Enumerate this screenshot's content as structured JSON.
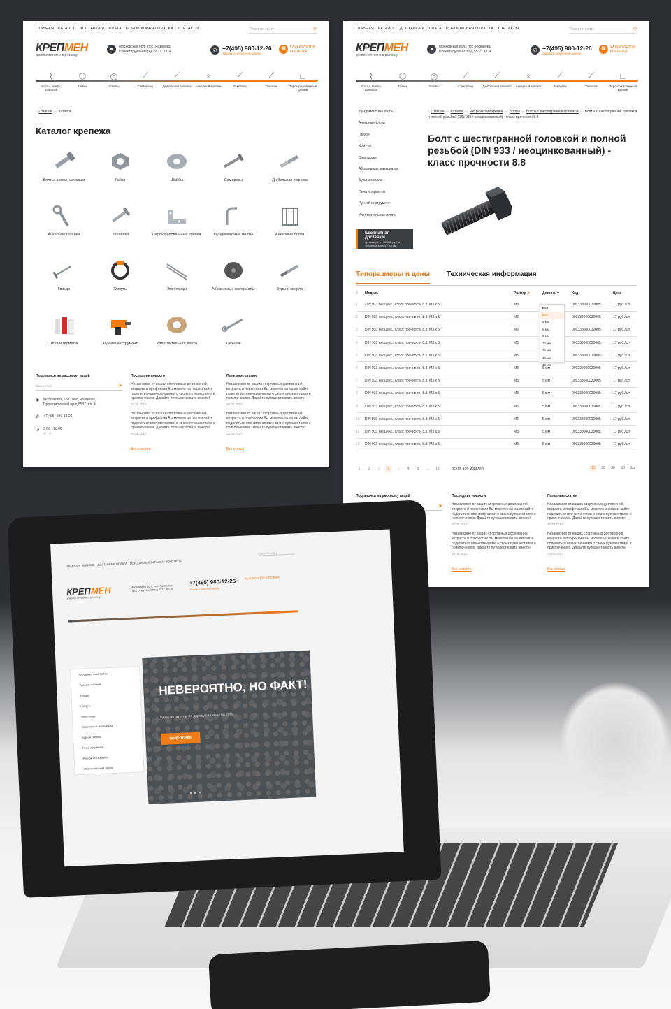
{
  "header": {
    "nav": [
      "ГЛАВНАЯ",
      "КАТАЛОГ",
      "ДОСТАВКА И ОПЛАТА",
      "ПОРОШКОВАЯ ОКРАСКА",
      "КОНТАКТЫ"
    ],
    "search_placeholder": "Поиск по сайту",
    "logo_dark": "КРЕП",
    "logo_orange": "МЕН",
    "slogan": "крепёж оптом и в розницу",
    "address": "Московская обл., пос. Развилка, Проектируемый пр-д 5537, вл. 4",
    "phone": "+7(495) 980-12-26",
    "callback": "Заказать обратный звонок",
    "calc": "КАЛЬКУЛЯТОР КРЕПЕЖА"
  },
  "category_strip": [
    "Болты, винты, шпильки",
    "Гайки",
    "Шайбы",
    "Саморезы",
    "Дюбельная техника",
    "Анкерный крепеж",
    "Заклёпки",
    "Такелаж",
    "Перфорированный крепеж"
  ],
  "left_page": {
    "breadcrumb": {
      "home": "Главная",
      "current": "Каталог"
    },
    "title": "Каталог крепежа",
    "catalog": [
      {
        "name": "Болты, винты, шпильки",
        "icon": "bolt-icon"
      },
      {
        "name": "Гайки",
        "icon": "nut-icon"
      },
      {
        "name": "Шайбы",
        "icon": "washer-icon"
      },
      {
        "name": "Саморезы",
        "icon": "screw-icon"
      },
      {
        "name": "Дюбельная техника",
        "icon": "dowel-icon"
      },
      {
        "name": "Анкерная техника",
        "icon": "anchor-icon"
      },
      {
        "name": "Заклёпки",
        "icon": "rivet-icon"
      },
      {
        "name": "Перфорирова-нный крепеж",
        "icon": "perforated-icon"
      },
      {
        "name": "Фундаментные болты",
        "icon": "foundation-bolt-icon"
      },
      {
        "name": "Анкерные блоки",
        "icon": "anchor-block-icon"
      },
      {
        "name": "Гвозди",
        "icon": "nail-icon"
      },
      {
        "name": "Хомуты",
        "icon": "clamp-icon"
      },
      {
        "name": "Электроды",
        "icon": "electrode-icon"
      },
      {
        "name": "Абразивные материалы",
        "icon": "abrasive-icon"
      },
      {
        "name": "Буры и сверла",
        "icon": "drill-bit-icon"
      },
      {
        "name": "Пена и герметик",
        "icon": "foam-icon"
      },
      {
        "name": "Ручной инструмент",
        "icon": "hand-tool-icon"
      },
      {
        "name": "Уплотнительная лента",
        "icon": "tape-icon"
      },
      {
        "name": "Такелаж",
        "icon": "rigging-icon"
      }
    ]
  },
  "footer": {
    "subscribe_title": "Подпишись на рассылку акций",
    "email_placeholder": "Ваш e-mail",
    "address": "Московская обл., пос. Развилка, Проектируемый пр-д 5537, вл. 4",
    "phone": "+7(495) 980-12-26",
    "hours": "9:00 - 18:00",
    "hours_days": "пн - пт",
    "news_title": "Последние новости",
    "articles_title": "Полезные статьи",
    "item_text": "Независимо от ваших спортивных достижений, возраста и профессии Вы можете на нашем сайте поделиться впечатлениями о своих путешествиях и приключениях. Давайте путешествовать вместе!",
    "item_date": "20.06.2017",
    "all_news": "Все новости",
    "all_articles": "Все статьи"
  },
  "right_page": {
    "sidebar": [
      "Фундаментные болты",
      "Анкерные блоки",
      "Гвозди",
      "Хомуты",
      "Электроды",
      "Абразивные материалы",
      "Буры и сверла",
      "Пена и герметик",
      "Ручной инструмент",
      "Уплотнительная лента"
    ],
    "promo_title": "Бесплатная доставка!",
    "promo_text": "при заказе от 10 000 руб. в пределах МКАД + 10 км",
    "breadcrumb": [
      "Главная",
      "Каталог",
      "Метрический крепеж",
      "Болты",
      "Болты с шестигранной головкой"
    ],
    "breadcrumb_current": "Болты с шестигранной головкой и полной резьбой (DIN 933 / неоцинкованный) - класс прочности 8.8",
    "title": "Болт с шестигранной головкой и полной резьбой (DIN 933 / неоцинкованный) - класс прочности 8.8",
    "tab_active": "Типоразмеры и цены",
    "tab_other": "Техническая информация",
    "table_head": [
      "#",
      "Модель",
      "Размер",
      "Длинна",
      "Код",
      "Цена"
    ],
    "filter_all": "Все",
    "rows": [
      {
        "n": "1",
        "model": "DIN 933 неоцинк., класс прочности 8.8, M3 x 5",
        "size": "M3",
        "len": "",
        "code": "009338000030005",
        "price": "17 руб./шт."
      },
      {
        "n": "2",
        "model": "DIN 933 неоцинк., класс прочности 8.8, M3 x 5",
        "size": "M3",
        "len": "",
        "code": "009338000030005",
        "price": "17 руб./шт."
      },
      {
        "n": "3",
        "model": "DIN 933 неоцинк., класс прочности 8.8, M3 x 5",
        "size": "M3",
        "len": "",
        "code": "009338000030005",
        "price": "17 руб./шт."
      },
      {
        "n": "4",
        "model": "DIN 933 неоцинк., класс прочности 8.8, M3 x 5",
        "size": "M3",
        "len": "",
        "code": "009338000030005",
        "price": "17 руб./шт."
      },
      {
        "n": "5",
        "model": "DIN 933 неоцинк., класс прочности 8.8, M3 x 5",
        "size": "M3",
        "len": "",
        "code": "009338000030005",
        "price": "17 руб./шт."
      },
      {
        "n": "6",
        "model": "DIN 933 неоцинк., класс прочности 8.8, M3 x 5",
        "size": "M3",
        "len": "5 мм",
        "code": "009338000030005",
        "price": "17 руб./шт."
      },
      {
        "n": "7",
        "model": "DIN 933 неоцинк., класс прочности 8.8, M3 x 5",
        "size": "M3",
        "len": "5 мм",
        "code": "009338000030005",
        "price": "17 руб./шт."
      },
      {
        "n": "8",
        "model": "DIN 933 неоцинк., класс прочности 8.8, M3 x 5",
        "size": "M3",
        "len": "5 мм",
        "code": "009338000030005",
        "price": "17 руб./шт."
      },
      {
        "n": "9",
        "model": "DIN 933 неоцинк., класс прочности 8.8, M3 x 5",
        "size": "M3",
        "len": "5 мм",
        "code": "009338000030005",
        "price": "17 руб./шт."
      },
      {
        "n": "10",
        "model": "DIN 933 неоцинк., класс прочности 8.8, M3 x 5",
        "size": "M3",
        "len": "5 мм",
        "code": "009338000030005",
        "price": "17 руб./шт."
      },
      {
        "n": "11",
        "model": "DIN 933 неоцинк., класс прочности 8.8, M3 x 5",
        "size": "M3",
        "len": "5 мм",
        "code": "009338000030005",
        "price": "17 руб./шт."
      },
      {
        "n": "12",
        "model": "DIN 933 неоцинк., класс прочности 8.8, M3 x 5",
        "size": "M3",
        "len": "5 мм",
        "code": "009338000030005",
        "price": "17 руб./шт."
      }
    ],
    "length_options": [
      "Все",
      "5 мм",
      "6 мм",
      "8 мм",
      "10 мм",
      "12 мм",
      "14 мм",
      "16 мм"
    ],
    "pager": [
      "1",
      "2",
      "3",
      "4",
      "5",
      "...",
      "12"
    ],
    "total": "Всего: 156 моделей",
    "per_page": [
      "12",
      "20",
      "30",
      "50",
      "Все"
    ]
  },
  "laptop_screen": {
    "menu": [
      "Фундаментные болты",
      "Анкерные блоки",
      "Гвозди",
      "Хомуты",
      "Электроды",
      "Абразивные материалы",
      "Буры и сверла",
      "Пена и герметик",
      "Ручной инструмент",
      "Уплотнительная лента"
    ],
    "banner_title": "НЕВЕРОЯТНО, НО ФАКТ!",
    "banner_sub": "Цены на шурупы по дереву снижены на 20%",
    "banner_button": "ПОДРОБНЕЕ"
  },
  "colors": {
    "accent": "#f07c18",
    "dark": "#2c3034"
  }
}
